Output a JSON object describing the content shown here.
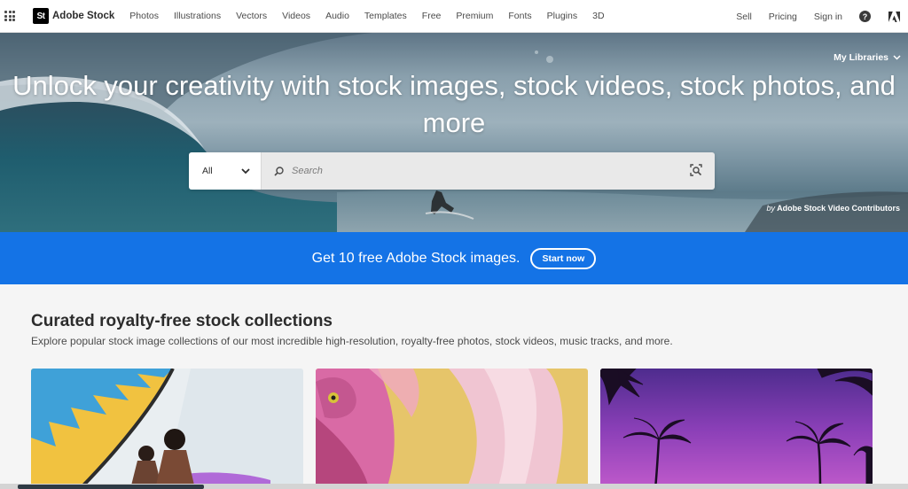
{
  "nav": {
    "brand_mark": "St",
    "brand": "Adobe Stock",
    "links": [
      "Photos",
      "Illustrations",
      "Vectors",
      "Videos",
      "Audio",
      "Templates",
      "Free",
      "Premium",
      "Fonts",
      "Plugins",
      "3D"
    ],
    "right_links": [
      "Sell",
      "Pricing",
      "Sign in"
    ],
    "help_glyph": "?",
    "icons": [
      "app-switcher-icon",
      "help-icon",
      "adobe-logo-icon"
    ]
  },
  "hero": {
    "title": "Unlock your creativity with stock images, stock videos, stock photos, and more",
    "my_libraries": "My Libraries",
    "credit_by": "by",
    "credit_name": "Adobe Stock Video Contributors"
  },
  "search": {
    "category": "All",
    "placeholder": "Search",
    "icons": [
      "search-icon",
      "visual-search-icon",
      "chevron-down-icon"
    ]
  },
  "promo": {
    "text": "Get 10 free Adobe Stock images.",
    "button": "Start now"
  },
  "collections": {
    "title": "Curated royalty-free stock collections",
    "subtitle": "Explore popular stock image collections of our most incredible high-resolution, royalty-free photos, stock videos, music tracks, and more."
  },
  "colors": {
    "accent": "#1473e6",
    "nav_bg": "#ffffff",
    "page_bg": "#f5f5f5"
  }
}
